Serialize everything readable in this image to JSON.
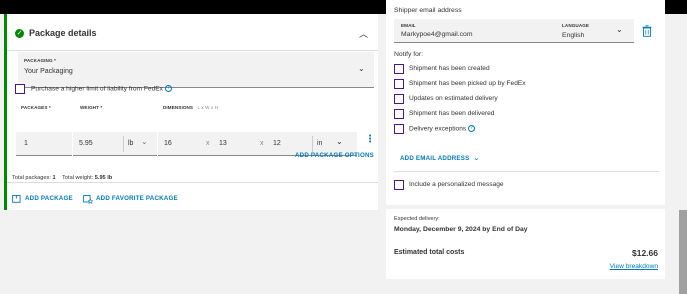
{
  "package_details": {
    "title": "Package details",
    "packaging_label": "PACKAGING *",
    "packaging_value": "Your Packaging",
    "liability_label": "Purchase a higher limit of liability from FedEx",
    "packages_label": "PACKAGES *",
    "weight_label": "WEIGHT *",
    "dimensions_label": "DIMENSIONS",
    "dimensions_hint": "L x W x H",
    "packages_value": "1",
    "weight_value": "5.95",
    "weight_unit": "lb",
    "dim_l": "16",
    "dim_w": "13",
    "dim_h": "12",
    "dim_unit": "in",
    "dim_x": "x",
    "add_package_options": "ADD PACKAGE OPTIONS",
    "total_packages_label": "Total packages:",
    "total_packages_value": "1",
    "total_weight_label": "Total weight:",
    "total_weight_value": "5.95 lb",
    "add_package": "ADD PACKAGE",
    "add_favorite_package": "ADD FAVORITE PACKAGE"
  },
  "notify": {
    "shipper_email_heading": "Shipper email address",
    "email_label": "EMAIL",
    "email_value": "Markypoe4@gmail.com",
    "language_label": "LANGUAGE",
    "language_value": "English",
    "notify_for": "Notify for:",
    "options": [
      "Shipment has been created",
      "Shipment has been picked up by FedEx",
      "Updates on estimated delivery",
      "Shipment has been delivered",
      "Delivery exceptions"
    ],
    "add_email": "ADD EMAIL ADDRESS",
    "personalized_message": "Include a personalized message"
  },
  "summary": {
    "expected_delivery_label": "Expected delivery:",
    "expected_delivery_value": "Monday, December 9, 2024 by End of Day",
    "estimated_total_label": "Estimated total costs",
    "estimated_total_value": "$12.66",
    "view_breakdown": "View breakdown"
  },
  "colors": {
    "fedex_purple": "#4d148c",
    "link_blue": "#007ab7",
    "success_green": "#008a00"
  },
  "icons": [
    "check-circle-icon",
    "chevron-up-icon",
    "chevron-down-icon",
    "info-icon",
    "kebab-icon",
    "package-icon",
    "favorite-package-icon",
    "trash-icon"
  ]
}
